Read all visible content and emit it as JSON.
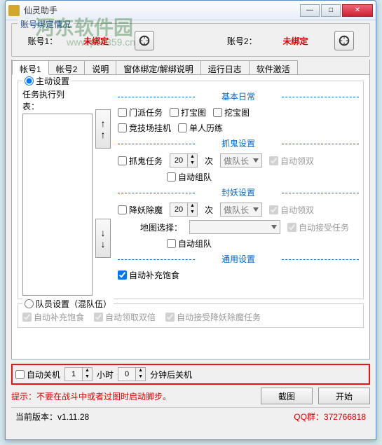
{
  "window": {
    "title": "仙灵助手"
  },
  "watermark": {
    "text": "河东软件园",
    "url": "www.pc0359.cn"
  },
  "winbtns": {
    "min": "—",
    "max": "□",
    "close": "✕"
  },
  "bind": {
    "group": "账号绑定情况",
    "acc1_label": "账号1：",
    "acc1_status": "未绑定",
    "acc2_label": "账号2：",
    "acc2_status": "未绑定"
  },
  "tabs": [
    "帐号1",
    "帐号2",
    "说明",
    "窗体绑定/解绑说明",
    "运行日志",
    "软件激活"
  ],
  "active": {
    "radio_label": "主动设置",
    "task_list_label": "任务执行列表：",
    "sections": {
      "basic": "基本日常",
      "ghost": "抓鬼设置",
      "monster": "封妖设置",
      "general": "通用设置"
    },
    "basic_items": [
      "门派任务",
      "打宝图",
      "挖宝图",
      "竞技场挂机",
      "单人历练"
    ],
    "ghost": {
      "task": "抓鬼任务",
      "times_val": "20",
      "times_unit": "次",
      "role": "做队长",
      "auto_double": "自动领双",
      "auto_team": "自动组队"
    },
    "monster": {
      "task": "降妖除魔",
      "times_val": "20",
      "times_unit": "次",
      "role": "做队长",
      "auto_double": "自动领双",
      "map_label": "地图选择：",
      "auto_accept": "自动接受任务",
      "auto_team": "自动组队"
    },
    "general": {
      "auto_food": "自动补充饱食"
    }
  },
  "team": {
    "radio_label": "队员设置（混队伍）",
    "items": [
      "自动补充饱食",
      "自动领取双倍",
      "自动接受降妖除魔任务"
    ]
  },
  "shutdown": {
    "auto": "自动关机",
    "hours": "1",
    "hours_label": "小时",
    "mins": "0",
    "mins_label": "分钟后关机"
  },
  "footer": {
    "hint": "提示：不要在战斗中或者过图时启动脚步。",
    "screenshot": "截图",
    "start": "开始"
  },
  "status": {
    "version_label": "当前版本：",
    "version": "v1.11.28",
    "qq_label": "QQ群：",
    "qq": "372766818"
  }
}
